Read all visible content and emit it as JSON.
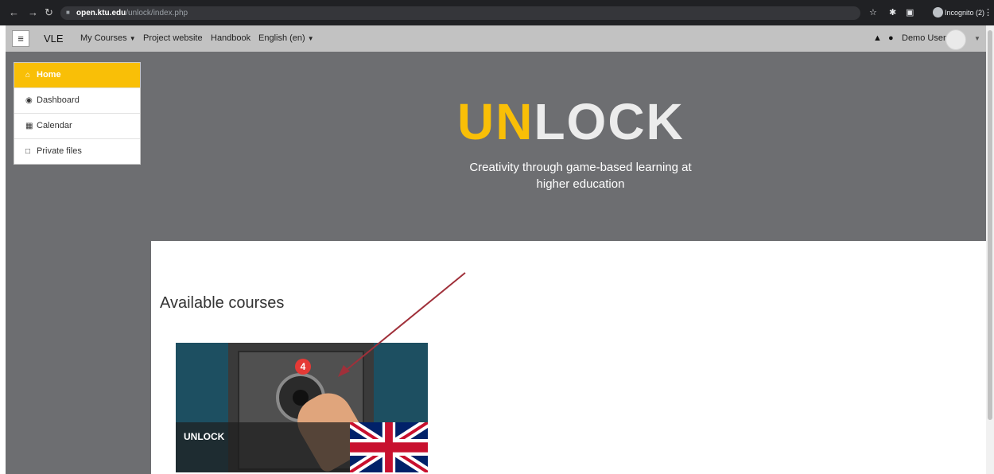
{
  "browser": {
    "url_host": "open.ktu.edu",
    "url_path": "/unlock/index.php",
    "incognito_label": "Incognito (2)"
  },
  "navbar": {
    "brand": "VLE",
    "links": [
      "My Courses",
      "Project website",
      "Handbook",
      "English (en)"
    ],
    "user_name": "Demo User"
  },
  "sidebar": {
    "items": [
      {
        "label": "Home",
        "icon": "home-icon"
      },
      {
        "label": "Dashboard",
        "icon": "dashboard-icon"
      },
      {
        "label": "Calendar",
        "icon": "calendar-icon"
      },
      {
        "label": "Private files",
        "icon": "file-icon"
      }
    ]
  },
  "hero": {
    "logo_un": "UN",
    "logo_lock": "LOCK",
    "tagline_line1": "Creativity through game-based learning at",
    "tagline_line2": "higher education"
  },
  "main": {
    "heading": "Available courses",
    "course": {
      "title": "UNLOCK",
      "badge": "4"
    }
  },
  "colors": {
    "accent": "#f9bf07",
    "hero_bg": "#6d6e71",
    "arrow": "#a0303a",
    "badge": "#e53935"
  }
}
